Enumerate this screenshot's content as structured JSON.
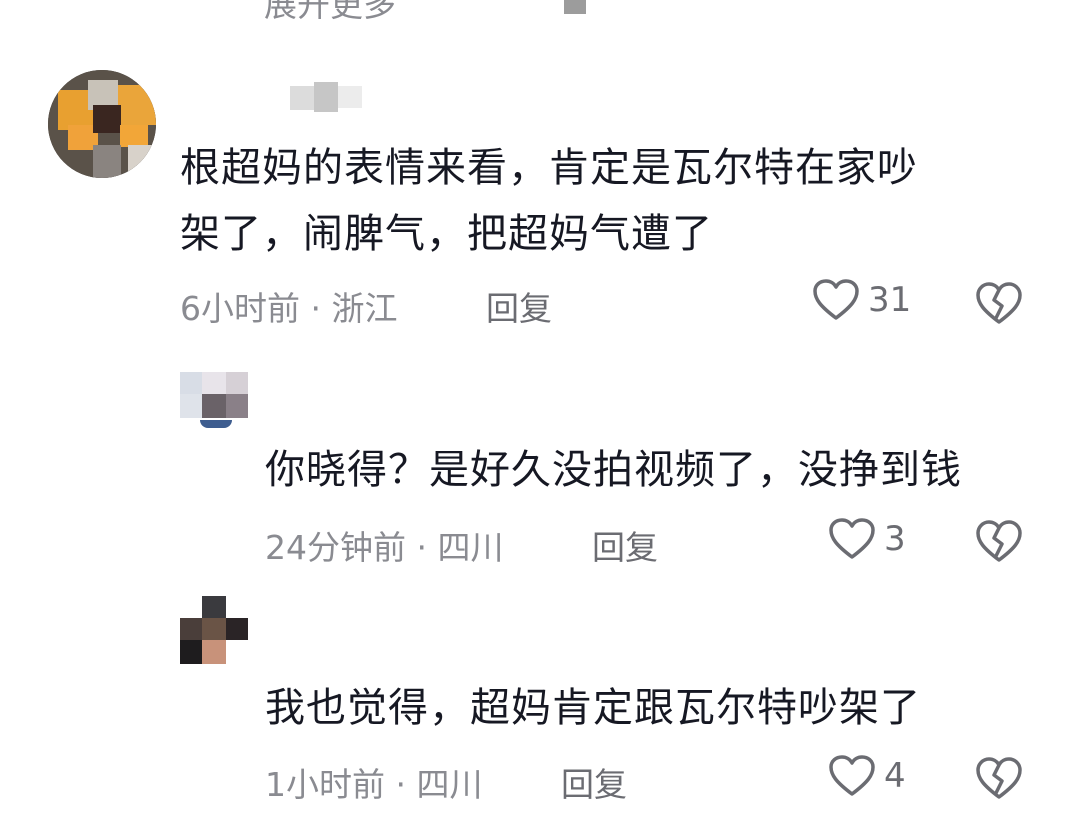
{
  "top": {
    "expand_label": "展开更多"
  },
  "comments": [
    {
      "text_line1": "根超妈的表情来看，肯定是瓦尔特在家吵",
      "text_line2": "架了，闹脾气，把超妈气遭了",
      "meta": "6小时前 · 浙江",
      "reply_label": "回复",
      "likes": "31",
      "icons": {
        "like": "heart-outline-icon",
        "dislike": "broken-heart-icon"
      }
    },
    {
      "text": "你晓得？是好久没拍视频了，没挣到钱",
      "meta": "24分钟前 · 四川",
      "reply_label": "回复",
      "likes": "3",
      "icons": {
        "like": "heart-outline-icon",
        "dislike": "broken-heart-icon"
      }
    },
    {
      "text": "我也觉得，超妈肯定跟瓦尔特吵架了",
      "meta": "1小时前 · 四川",
      "reply_label": "回复",
      "likes": "4",
      "icons": {
        "like": "heart-outline-icon",
        "dislike": "broken-heart-icon"
      }
    }
  ],
  "colors": {
    "text": "#161823",
    "meta": "#8a8b91",
    "icon": "#6b6c72",
    "background": "#ffffff"
  }
}
